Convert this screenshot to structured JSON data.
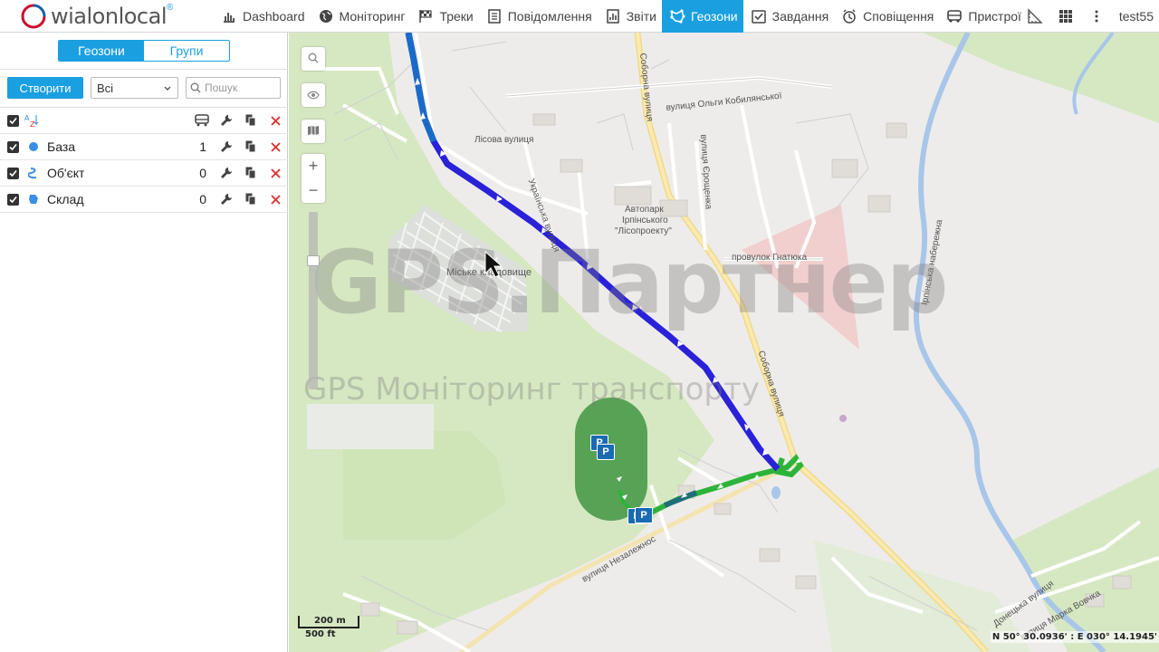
{
  "app": {
    "brand": "wialon local",
    "brand_main": "wialon",
    "brand_suffix": "local",
    "brand_mark": "®",
    "user": "test55"
  },
  "nav": {
    "items": [
      {
        "label": "Dashboard",
        "icon": "bar-chart-icon",
        "active": false
      },
      {
        "label": "Моніторинг",
        "icon": "globe-icon",
        "active": false
      },
      {
        "label": "Треки",
        "icon": "flag-icon",
        "active": false
      },
      {
        "label": "Повідомлення",
        "icon": "document-icon",
        "active": false
      },
      {
        "label": "Звіти",
        "icon": "report-icon",
        "active": false
      },
      {
        "label": "Геозони",
        "icon": "geofence-icon",
        "active": true
      },
      {
        "label": "Завдання",
        "icon": "task-icon",
        "active": false
      },
      {
        "label": "Сповіщення",
        "icon": "alarm-icon",
        "active": false
      },
      {
        "label": "Пристрої",
        "icon": "truck-icon",
        "active": false
      }
    ]
  },
  "panel": {
    "tabs": [
      {
        "label": "Геозони",
        "active": true
      },
      {
        "label": "Групи",
        "active": false
      }
    ],
    "create_label": "Створити",
    "filter_value": "Всі",
    "search_placeholder": "Пошук",
    "rows": [
      {
        "name": "База",
        "count": "1",
        "icon": "circle-geofence-icon",
        "color": "#3a8ee6"
      },
      {
        "name": "Об'єкт",
        "count": "0",
        "icon": "line-geofence-icon",
        "color": "#3a8ee6"
      },
      {
        "name": "Склад",
        "count": "0",
        "icon": "polygon-geofence-icon",
        "color": "#3a8ee6"
      }
    ]
  },
  "map": {
    "labels": {
      "lisova": "Лісова вулиця",
      "ukrainska": "Українська вулиця",
      "soborna_top": "Соборна вулиця",
      "kobylianska": "вулиця Ольги Кобилянської",
      "yeroshchenka": "вулиця Єрощенка",
      "autopark_1": "Автопарк",
      "autopark_2": "Ірпінського",
      "autopark_3": "\"Лісопроекту\"",
      "cemetery": "Міське кладовище",
      "hnatiuka": "провулок Гнатюка",
      "soborna_mid": "Соборна вулиця",
      "irpinska": "Ірпінська набережна",
      "nezalezhnosti": "вулиця Незалежнос",
      "donetska": "Донецька вулиця",
      "vovchka": "вулиця Марка Вовчка"
    },
    "watermark_big": "GPS.Партнер",
    "watermark_small": "GPS Моніторинг транспорту",
    "scale_metric": "200 m",
    "scale_imperial": "500 ft",
    "coordinates": "N 50° 30.0936' : E 030° 14.1945'",
    "parking_letter": "P",
    "colors": {
      "accent": "#1a9fe0",
      "track_blue": "#2a22d8",
      "track_green": "#2db33a",
      "geofence": "#4a9a4a",
      "delete": "#d9302c"
    }
  }
}
